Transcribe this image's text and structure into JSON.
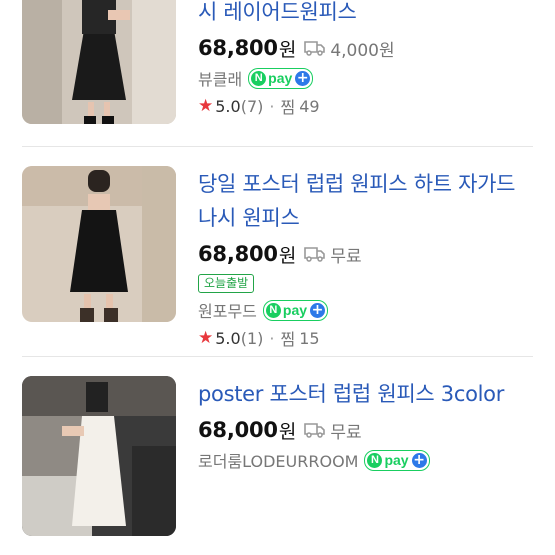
{
  "products": [
    {
      "title": "시 레이어드원피스",
      "price": "68,800",
      "price_unit": "원",
      "shipping": "4,000원",
      "seller": "뷰클래",
      "rating": "5.0",
      "review_count": "(7)",
      "wish_label": "찜",
      "wish_count": "49"
    },
    {
      "title_line1": "당일 포스터 럽럽 원피스 하트 자가드",
      "title_line2": "나시 원피스",
      "price": "68,800",
      "price_unit": "원",
      "shipping": "무료",
      "badge": "오늘출발",
      "seller": "원포무드",
      "rating": "5.0",
      "review_count": "(1)",
      "wish_label": "찜",
      "wish_count": "15"
    },
    {
      "title": "poster 포스터 럽럽 원피스 3color",
      "price": "68,000",
      "price_unit": "원",
      "shipping": "무료",
      "seller": "로더룸LODEURROOM"
    }
  ],
  "npay": {
    "n": "N",
    "label": "pay",
    "plus": "+"
  },
  "icons": {
    "truck": "truck-icon",
    "star": "star-icon"
  },
  "colors": {
    "title": "#2a5ab8",
    "npay_green": "#19ce60",
    "npay_blue": "#2d79e8",
    "star": "#e8383d"
  }
}
